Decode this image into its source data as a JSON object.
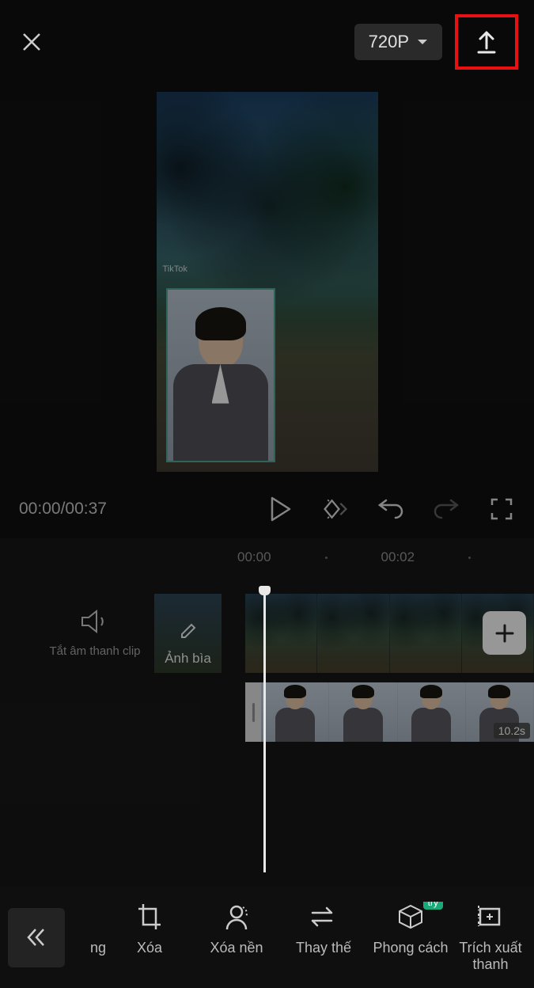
{
  "header": {
    "resolution": "720P"
  },
  "preview": {
    "watermark": "TikTok"
  },
  "playback": {
    "current": "00:00",
    "total": "00:37"
  },
  "ruler": {
    "t0": "00:00",
    "t1": "00:02"
  },
  "timeline": {
    "mute_label": "Tắt âm thanh clip",
    "cover_label": "Ảnh bìa",
    "overlay_duration": "10.2s"
  },
  "toolbar": {
    "partial_left": "ng",
    "crop": "Xóa",
    "remove_bg": "Xóa nền",
    "replace": "Thay thế",
    "style": "Phong cách",
    "style_badge": "try",
    "extract": "Trích xuất thanh"
  }
}
